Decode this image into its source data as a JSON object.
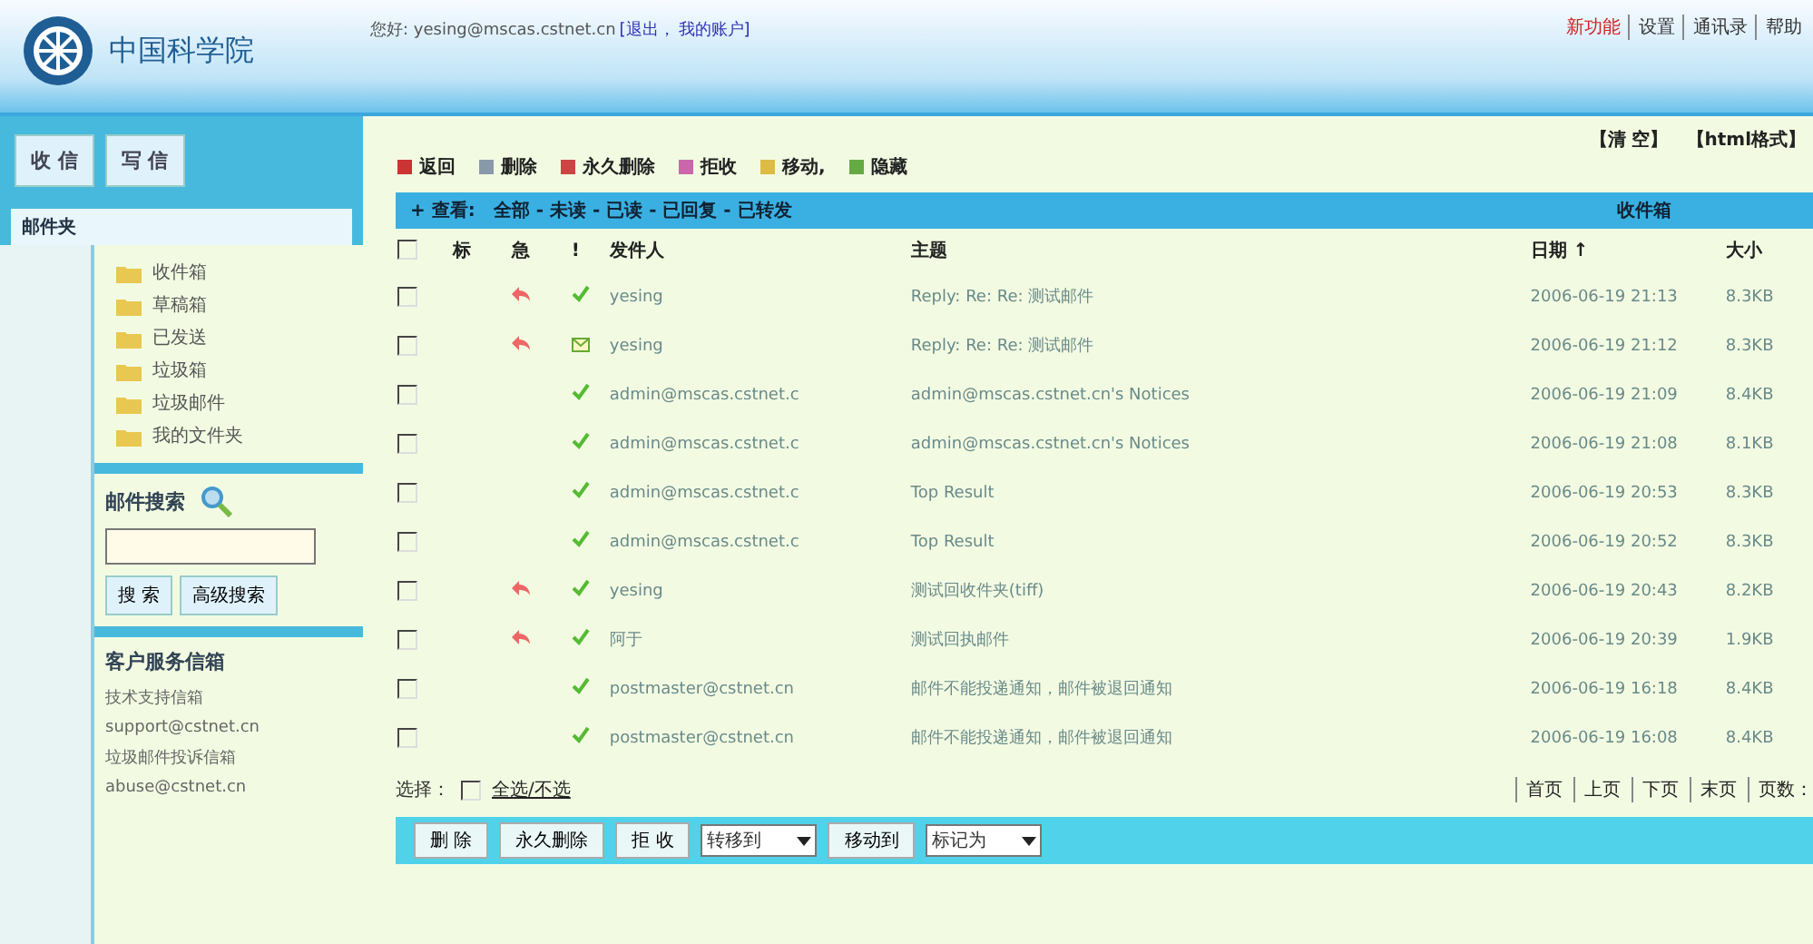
{
  "header": {
    "logo": "中国科学院",
    "user_line": "您好: yesing@mscas.cstnet.cn",
    "user_links": [
      "[退出，",
      "我的账户]"
    ],
    "top_links": [
      {
        "label": "新功能",
        "highlight": true
      },
      {
        "label": "设置",
        "highlight": false
      },
      {
        "label": "通讯录",
        "highlight": false
      },
      {
        "label": "帮助",
        "highlight": false
      }
    ]
  },
  "sidebar": {
    "buttons": [
      "收 信",
      "写 信"
    ],
    "folder_title": "邮件夹",
    "folders": [
      "收件箱",
      "草稿箱",
      "已发送",
      "垃圾箱",
      "垃圾邮件",
      "我的文件夹"
    ],
    "search": {
      "title": "邮件搜索",
      "buttons": [
        "搜 索",
        "高级搜索"
      ]
    },
    "service": {
      "title": "客户服务信箱",
      "lines": [
        "技术支持信箱",
        "support@cstnet.cn",
        "垃圾邮件投诉信箱",
        "abuse@cstnet.cn"
      ]
    }
  },
  "toolbar": {
    "actions": [
      "返回",
      "删除",
      "永久删除",
      "拒收",
      "移动,",
      "隐藏"
    ],
    "right_links": [
      "【清 空】",
      "【html格式】"
    ]
  },
  "view_bar": {
    "label": "+ 查看:",
    "filters": "全部 - 未读 - 已读 - 已回复 - 已转发",
    "folder": "收件箱"
  },
  "table": {
    "all_checked": false,
    "columns": [
      "标",
      "急",
      "!",
      "发件人",
      "主题",
      "日期 ↑",
      "大小"
    ],
    "rows": [
      {
        "checked": false,
        "replied": true,
        "read": true,
        "sender": "yesing",
        "subject": "Reply: Re: Re: 测试邮件",
        "date": "2006-06-19 21:13",
        "size": "8.3KB"
      },
      {
        "checked": false,
        "replied": true,
        "read": false,
        "sender": "yesing",
        "subject": "Reply: Re: Re: 测试邮件",
        "date": "2006-06-19 21:12",
        "size": "8.3KB"
      },
      {
        "checked": false,
        "replied": false,
        "read": true,
        "sender": "admin@mscas.cstnet.c",
        "subject": "admin@mscas.cstnet.cn's Notices",
        "date": "2006-06-19 21:09",
        "size": "8.4KB"
      },
      {
        "checked": false,
        "replied": false,
        "read": true,
        "sender": "admin@mscas.cstnet.c",
        "subject": "admin@mscas.cstnet.cn's Notices",
        "date": "2006-06-19 21:08",
        "size": "8.1KB"
      },
      {
        "checked": false,
        "replied": false,
        "read": true,
        "sender": "admin@mscas.cstnet.c",
        "subject": "Top Result",
        "date": "2006-06-19 20:53",
        "size": "8.3KB"
      },
      {
        "checked": false,
        "replied": false,
        "read": true,
        "sender": "admin@mscas.cstnet.c",
        "subject": "Top Result",
        "date": "2006-06-19 20:52",
        "size": "8.3KB"
      },
      {
        "checked": false,
        "replied": true,
        "read": true,
        "sender": "yesing",
        "subject": "测试回收件夹(tiff)",
        "date": "2006-06-19 20:43",
        "size": "8.2KB"
      },
      {
        "checked": false,
        "replied": true,
        "read": true,
        "sender": "阿于",
        "subject": "测试回执邮件",
        "date": "2006-06-19 20:39",
        "size": "1.9KB"
      },
      {
        "checked": false,
        "replied": false,
        "read": true,
        "sender": "postmaster@cstnet.cn",
        "subject": "邮件不能投递通知，邮件被退回通知",
        "date": "2006-06-19 16:18",
        "size": "8.4KB"
      },
      {
        "checked": false,
        "replied": false,
        "read": true,
        "sender": "postmaster@cstnet.cn",
        "subject": "邮件不能投递通知，邮件被退回通知",
        "date": "2006-06-19 16:08",
        "size": "8.4KB"
      }
    ]
  },
  "select_row": {
    "label": "选择：",
    "checked": false,
    "link": "全选/不选"
  },
  "pager": [
    "首页",
    "上页",
    "下页",
    "末页",
    "页数："
  ],
  "bottom_bar": [
    {
      "kind": "button",
      "label": "删 除"
    },
    {
      "kind": "button",
      "label": "永久删除"
    },
    {
      "kind": "button",
      "label": "拒 收"
    },
    {
      "kind": "select",
      "label": "转移到"
    },
    {
      "kind": "button",
      "label": "移动到"
    },
    {
      "kind": "select",
      "label": "标记为"
    }
  ]
}
